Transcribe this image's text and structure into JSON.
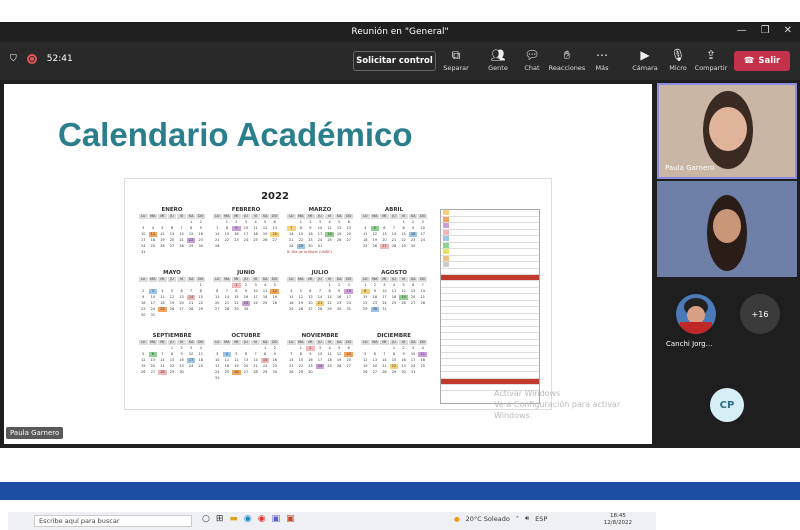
{
  "window": {
    "title": "Reunión en \"General\"",
    "minimize": "—",
    "restore": "❐",
    "close": "✕"
  },
  "toolbar": {
    "timer": "52:41",
    "request_control": "Solicitar control",
    "buttons": [
      {
        "label": "Separar",
        "icon": "pop-out-icon"
      },
      {
        "label": "Gente",
        "icon": "people-icon"
      },
      {
        "label": "Chat",
        "icon": "chat-icon"
      },
      {
        "label": "Reacciones",
        "icon": "reactions-icon"
      },
      {
        "label": "Más",
        "icon": "more-icon"
      },
      {
        "label": "Cámara",
        "icon": "camera-off-icon"
      },
      {
        "label": "Micro",
        "icon": "mic-off-icon"
      },
      {
        "label": "Compartir",
        "icon": "share-icon"
      }
    ],
    "leave": "Salir"
  },
  "slide": {
    "title": "Calendario Académico",
    "year": "2022",
    "months": [
      "ENERO",
      "FEBRERO",
      "MARZO",
      "ABRIL",
      "MAYO",
      "JUNIO",
      "JULIO",
      "AGOSTO",
      "SEPTIEMBRE",
      "OCTUBRE",
      "NOVIEMBRE",
      "DICIEMBRE"
    ],
    "weekdays": [
      "LU",
      "MA",
      "MI",
      "JU",
      "VI",
      "SA",
      "DO"
    ],
    "month_notes": {
      "MARZO": "8: Día de la Mujer (UNRC)"
    }
  },
  "watermark": {
    "line1": "Activar Windows",
    "line2": "Ve a Configuración para activar Windows."
  },
  "taskbar": {
    "presenter_chip": "Paula Garnero",
    "search_placeholder": "Escribe aquí para buscar",
    "weather": "20°C  Soleado",
    "lang": "ESP",
    "time": "18:45",
    "date": "12/8/2022"
  },
  "participants": {
    "tile1_name": "Paula Garnero",
    "avatar_name": "Canchi Jorg...",
    "more_count": "+16",
    "cp_initials": "CP"
  },
  "colors": {
    "accent_title": "#2b7e8c",
    "leave": "#c4314b",
    "active_tile_border": "#8c8ce0"
  }
}
